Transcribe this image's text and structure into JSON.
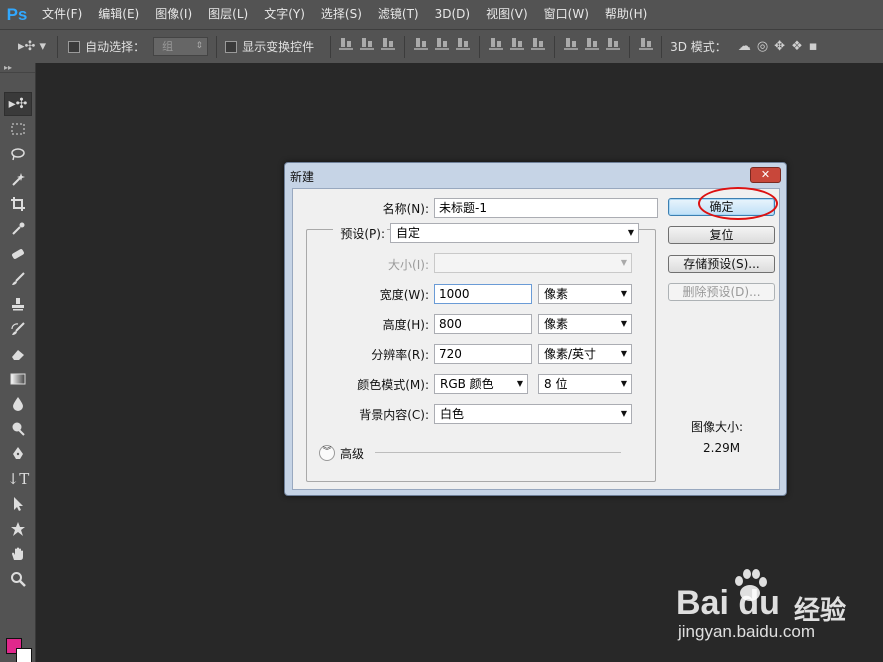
{
  "app": {
    "logo": "Ps"
  },
  "menu": [
    "文件(F)",
    "编辑(E)",
    "图像(I)",
    "图层(L)",
    "文字(Y)",
    "选择(S)",
    "滤镜(T)",
    "3D(D)",
    "视图(V)",
    "窗口(W)",
    "帮助(H)"
  ],
  "options": {
    "auto_select_label": "自动选择：",
    "auto_select_value": "组",
    "show_transform_label": "显示变换控件",
    "mode_3d_label": "3D 模式："
  },
  "colors": {
    "foreground": "#e0288c",
    "background": "#ffffff",
    "accent": "#31a8ff"
  },
  "dialog": {
    "title": "新建",
    "close_label": "✕",
    "name_label": "名称(N):",
    "name_value": "未标题-1",
    "preset_label": "预设(P):",
    "preset_value": "自定",
    "size_label": "大小(I):",
    "size_value": "",
    "width_label": "宽度(W):",
    "width_value": "1000",
    "width_unit": "像素",
    "height_label": "高度(H):",
    "height_value": "800",
    "height_unit": "像素",
    "resolution_label": "分辨率(R):",
    "resolution_value": "720",
    "resolution_unit": "像素/英寸",
    "color_mode_label": "颜色模式(M):",
    "color_mode_value": "RGB 颜色",
    "bit_depth_value": "8 位",
    "bg_content_label": "背景内容(C):",
    "bg_content_value": "白色",
    "advanced_label": "高级",
    "ok_button": "确定",
    "reset_button": "复位",
    "save_preset_button": "存储预设(S)...",
    "delete_preset_button": "删除预设(D)...",
    "image_size_label": "图像大小:",
    "image_size_value": "2.29M"
  },
  "watermark": {
    "logo": "Bai du",
    "brand": "经验",
    "url": "jingyan.baidu.com"
  }
}
